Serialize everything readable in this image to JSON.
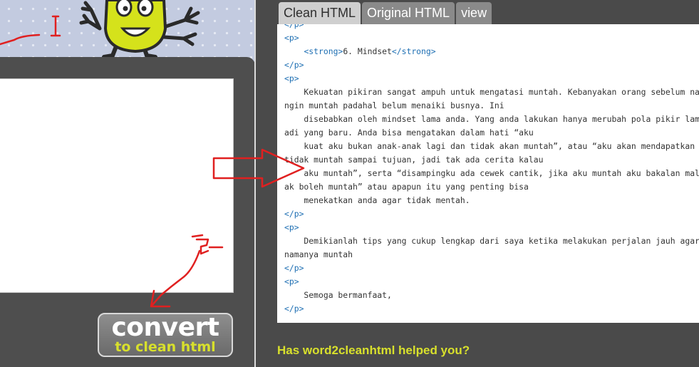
{
  "convert_button": {
    "main": "convert",
    "sub": "to clean html"
  },
  "tabs": [
    {
      "label": "Clean HTML",
      "active": true
    },
    {
      "label": "Original HTML",
      "active": false
    },
    {
      "label": "view",
      "active": false
    }
  ],
  "code_lines": [
    "</p>",
    "<p>",
    "    <strong>6. Mindset</strong>",
    "</p>",
    "<p>",
    "    Kekuatan pikiran sangat ampuh untuk mengatasi muntah. Kebanyakan orang sebelum naik bus sudah me",
    "ngin muntah padahal belum menaiki busnya. Ini",
    "    disebabkan oleh mindset lama anda. Yang anda lakukan hanya merubah pola pikir lama anda menj",
    "adi yang baru. Anda bisa mengatakan dalam hati “aku",
    "    kuat aku bukan anak-anak lagi dan tidak akan muntah”, atau “aku akan mendapatkan hadiah jika",
    "tidak muntah sampai tujuan, jadi tak ada cerita kalau",
    "    aku muntah”, serta “disampingku ada cewek cantik, jika aku muntah aku bakalan malu, jadi tid",
    "ak boleh muntah” atau apapun itu yang penting bisa",
    "    menekatkan anda agar tidak mentah.",
    "</p>",
    "<p>",
    "    Demikianlah tips yang cukup lengkap dari saya ketika melakukan perjalan jauh agar terhindar",
    "namanya muntah",
    "</p>",
    "<p>",
    "    Semoga bermanfaat,",
    "</p>"
  ],
  "footer_prompt": "Has word2cleanhtml helped you?",
  "colors": {
    "accent_yellow": "#d8e02c",
    "annotation_red": "#e02020",
    "tag_blue": "#1e6fb3",
    "panel_dark": "#4a4a4a"
  }
}
